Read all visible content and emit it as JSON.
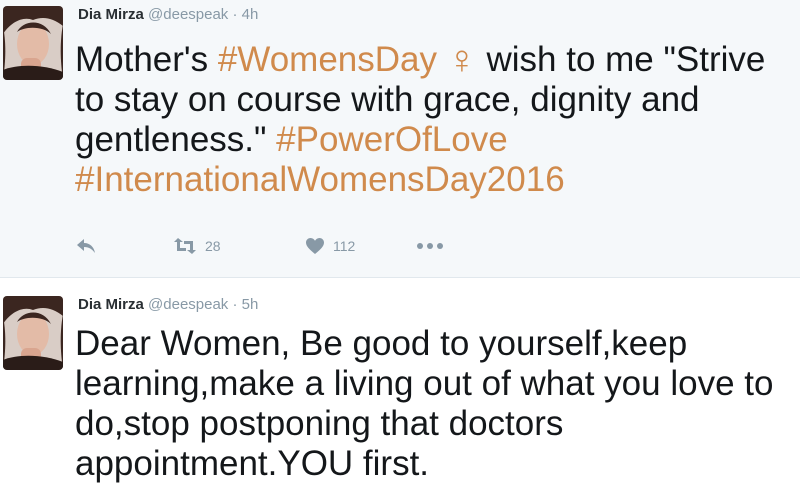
{
  "tweets": [
    {
      "author": "Dia Mirza",
      "handle": "@deespeak",
      "separator": "·",
      "time": "4h",
      "text_before": "Mother's ",
      "hashtag1": "#WomensDay",
      "emoji": "♀",
      "text_mid": " wish to me \"Strive to stay on course with grace, dignity and gentleness.\" ",
      "hashtag2": "#PowerOfLove",
      "hashtag3": "#InternationalWomensDay2016",
      "retweets": "28",
      "likes": "112"
    },
    {
      "author": "Dia Mirza",
      "handle": "@deespeak",
      "separator": "·",
      "time": "5h",
      "text": "Dear Women, Be good to yourself,keep learning,make a living out of what you love to do,stop postponing that doctors appointment.YOU first."
    }
  ],
  "colors": {
    "hashtag": "#d08a4c",
    "meta": "#8899a6",
    "background_highlight": "#f5f8fa"
  },
  "icons": [
    "reply-icon",
    "retweet-icon",
    "heart-icon",
    "more-icon"
  ]
}
